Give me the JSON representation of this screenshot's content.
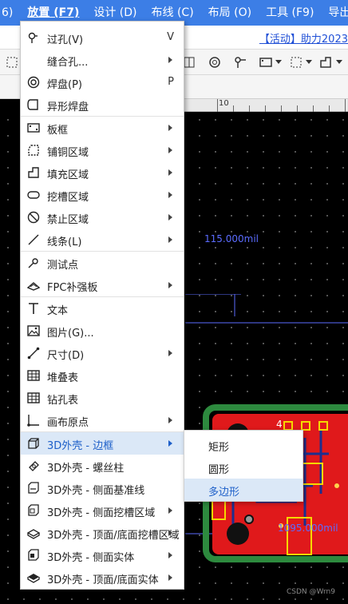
{
  "menubar": {
    "items": [
      {
        "label": "6)"
      },
      {
        "label": "放置 (F7)"
      },
      {
        "label": "设计 (D)"
      },
      {
        "label": "布线 (C)"
      },
      {
        "label": "布局 (O)"
      },
      {
        "label": "工具 (F9)"
      },
      {
        "label": "导出"
      }
    ]
  },
  "promo": {
    "text": "【活动】助力2023"
  },
  "ruler": {
    "label": "10"
  },
  "canvas": {
    "dim_top": "115.000mil",
    "dim_bottom": "1095.000mil",
    "pcb_label": "4"
  },
  "place_menu": {
    "items": [
      {
        "label": "过孔(V)",
        "shortcut": "V",
        "icon": "via-icon"
      },
      {
        "label": "缝合孔...",
        "shortcut": "",
        "icon": "stitch-via-icon"
      },
      {
        "label": "焊盘(P)",
        "shortcut": "P",
        "icon": "pad-icon"
      },
      {
        "label": "异形焊盘",
        "shortcut": "",
        "icon": "custom-pad-icon"
      },
      {
        "label": "板框",
        "shortcut": "",
        "icon": "board-outline-icon"
      },
      {
        "label": "铺铜区域",
        "shortcut": "",
        "icon": "copper-area-icon"
      },
      {
        "label": "填充区域",
        "shortcut": "",
        "icon": "fill-area-icon"
      },
      {
        "label": "挖槽区域",
        "shortcut": "",
        "icon": "slot-area-icon"
      },
      {
        "label": "禁止区域",
        "shortcut": "",
        "icon": "forbidden-area-icon"
      },
      {
        "label": "线条(L)",
        "shortcut": "",
        "icon": "line-icon"
      },
      {
        "label": "测试点",
        "shortcut": "",
        "icon": "test-point-icon"
      },
      {
        "label": "FPC补强板",
        "shortcut": "",
        "icon": "fpc-stiffener-icon"
      },
      {
        "label": "文本",
        "shortcut": "",
        "icon": "text-icon"
      },
      {
        "label": "图片(G)...",
        "shortcut": "",
        "icon": "image-icon"
      },
      {
        "label": "尺寸(D)",
        "shortcut": "",
        "icon": "dimension-icon"
      },
      {
        "label": "堆叠表",
        "shortcut": "",
        "icon": "stackup-table-icon"
      },
      {
        "label": "钻孔表",
        "shortcut": "",
        "icon": "drill-table-icon"
      },
      {
        "label": "画布原点",
        "shortcut": "",
        "icon": "canvas-origin-icon"
      },
      {
        "label": "3D外壳 - 边框",
        "shortcut": "",
        "icon": "3d-shell-frame-icon"
      },
      {
        "label": "3D外壳 - 螺丝柱",
        "shortcut": "",
        "icon": "3d-screw-post-icon"
      },
      {
        "label": "3D外壳 - 侧面基准线",
        "shortcut": "",
        "icon": "3d-side-datum-icon"
      },
      {
        "label": "3D外壳 - 侧面挖槽区域",
        "shortcut": "",
        "icon": "3d-side-slot-icon"
      },
      {
        "label": "3D外壳 - 顶面/底面挖槽区域",
        "shortcut": "",
        "icon": "3d-top-bottom-slot-icon"
      },
      {
        "label": "3D外壳 - 侧面实体",
        "shortcut": "",
        "icon": "3d-side-solid-icon"
      },
      {
        "label": "3D外壳 - 顶面/底面实体",
        "shortcut": "",
        "icon": "3d-top-bottom-solid-icon"
      }
    ]
  },
  "shell_submenu": {
    "items": [
      {
        "label": "矩形"
      },
      {
        "label": "圆形"
      },
      {
        "label": "多边形"
      }
    ]
  },
  "watermark": {
    "text": "CSDN @Wrn9"
  },
  "colors": {
    "menubar": "#3c7ee6",
    "highlight": "#dbe8f7",
    "board_copper": "#e0191b",
    "board_edge": "#2d8a3e",
    "dimension": "#5b6cff"
  }
}
